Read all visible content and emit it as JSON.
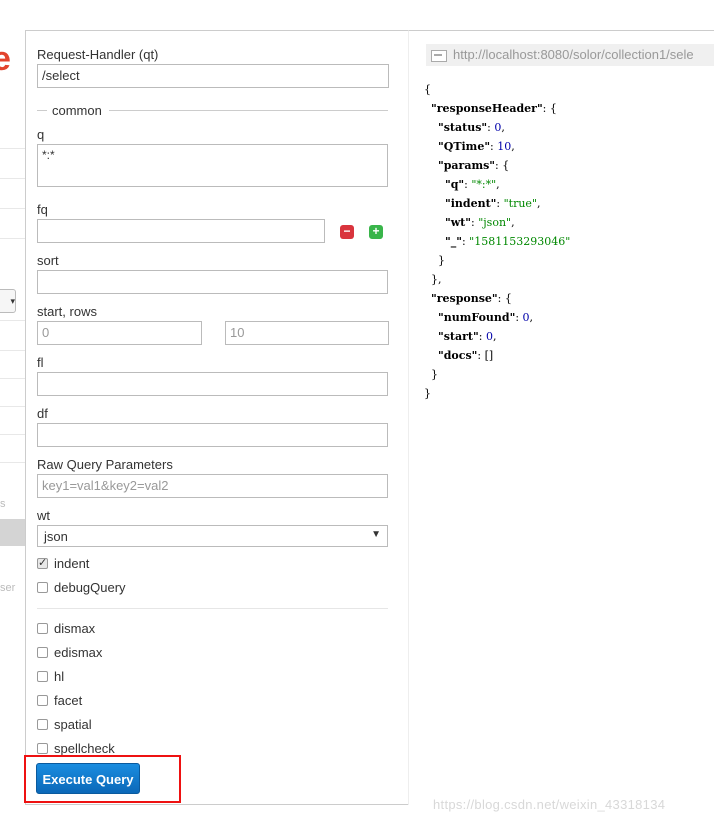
{
  "form": {
    "request_handler_label": "Request-Handler (qt)",
    "request_handler_value": "/select",
    "common_legend": "common",
    "q_label": "q",
    "q_value": "*:*",
    "fq_label": "fq",
    "fq_value": "",
    "sort_label": "sort",
    "sort_value": "",
    "start_rows_label": "start, rows",
    "start_placeholder": "0",
    "rows_placeholder": "10",
    "fl_label": "fl",
    "fl_value": "",
    "df_label": "df",
    "df_value": "",
    "raw_label": "Raw Query Parameters",
    "raw_placeholder": "key1=val1&key2=val2",
    "wt_label": "wt",
    "wt_selected": "json",
    "checkboxes_top": [
      {
        "label": "indent",
        "checked": true
      },
      {
        "label": "debugQuery",
        "checked": false
      }
    ],
    "checkboxes_bottom": [
      {
        "label": "dismax",
        "checked": false
      },
      {
        "label": "edismax",
        "checked": false
      },
      {
        "label": "hl",
        "checked": false
      },
      {
        "label": "facet",
        "checked": false
      },
      {
        "label": "spatial",
        "checked": false
      },
      {
        "label": "spellcheck",
        "checked": false
      }
    ],
    "execute_label": "Execute Query"
  },
  "sidebar_fragments": {
    "logo_char": "e",
    "text_s": "s",
    "text_ser": "ser"
  },
  "result": {
    "url": "http://localhost:8080/solor/collection1/sele",
    "lines": [
      "{",
      "  \"responseHeader\": {",
      "    \"status\": 0,",
      "    \"QTime\": 10,",
      "    \"params\": {",
      "      \"q\": \"*:*\",",
      "      \"indent\": \"true\",",
      "      \"wt\": \"json\",",
      "      \"_\": \"1581153293046\"",
      "    }",
      "  },",
      "  \"response\": {",
      "    \"numFound\": 0,",
      "    \"start\": 0,",
      "    \"docs\": []",
      "  }",
      "}"
    ]
  },
  "watermark": "https://blog.csdn.net/weixin_43318134",
  "colors": {
    "accent_button": "#1479cf",
    "highlight_border": "#e11111",
    "remove_button": "#d9343d",
    "add_button": "#39b54a",
    "json_number": "#0000aa",
    "json_string": "#008800"
  }
}
